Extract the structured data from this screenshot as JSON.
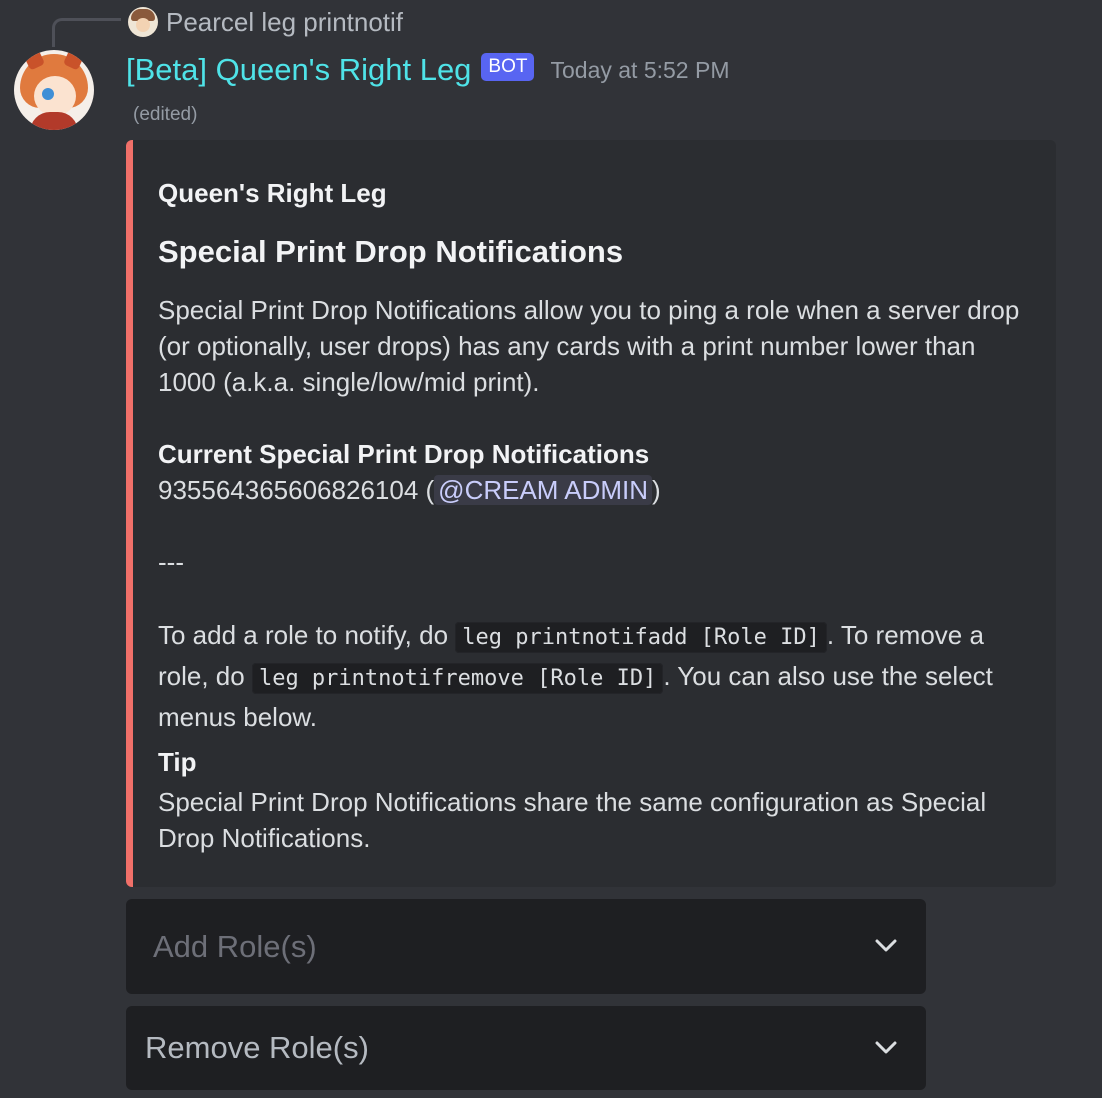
{
  "reply": {
    "text": "Pearcel leg printnotif"
  },
  "message": {
    "author": "[Beta] Queen's Right Leg",
    "badge": "BOT",
    "timestamp": "Today at 5:52 PM",
    "edited": "(edited)"
  },
  "embed": {
    "accent_color": "#f07069",
    "author": "Queen's Right Leg",
    "title": "Special Print Drop Notifications",
    "description": "Special Print Drop Notifications allow you to ping a role when a server drop (or optionally, user drops) has any cards with a print number lower than 1000 (a.k.a. single/low/mid print).",
    "current_heading": "Current Special Print Drop Notifications",
    "current_role_id": "935564365606826104",
    "current_role_open": " (",
    "current_role_mention": "@CREAM ADMIN",
    "current_role_close": ")",
    "separator": "---",
    "instructions": {
      "part1": "To add a role to notify, do ",
      "code_add": "leg printnotifadd [Role ID]",
      "part2": ". To remove a role, do ",
      "code_remove": "leg printnotifremove [Role ID]",
      "part3": ". You can also use the select menus below."
    },
    "tip_heading": "Tip",
    "tip_text": "Special Print Drop Notifications share the same configuration as Special Drop Notifications."
  },
  "components": {
    "add_select_placeholder": "Add Role(s)",
    "remove_select_placeholder": "Remove Role(s)"
  },
  "icons": {
    "dropdown": "chevron-down-icon"
  }
}
